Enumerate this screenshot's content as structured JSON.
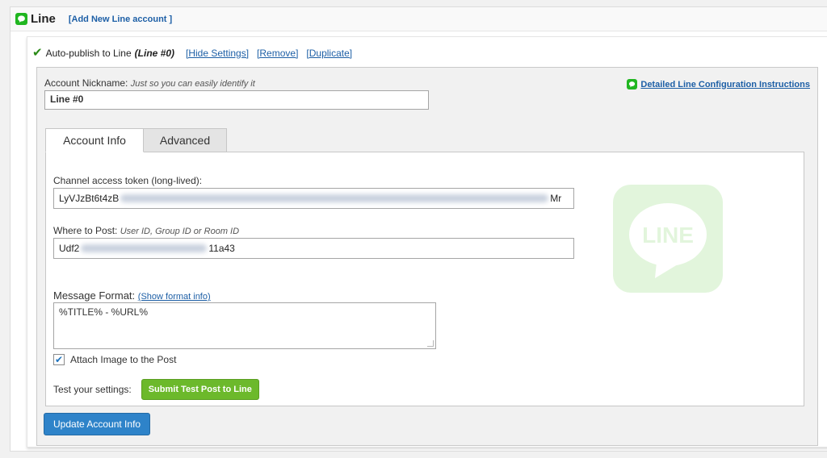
{
  "header": {
    "title": "Line",
    "add_link": "[Add New Line account ]"
  },
  "publish_row": {
    "checkbox_label": "Auto-publish to Line",
    "account_ref": "(Line #0)",
    "hide_settings": "[Hide Settings]",
    "remove": "[Remove]",
    "duplicate": "[Duplicate]"
  },
  "account": {
    "nickname_label": "Account Nickname:",
    "nickname_hint": "Just so you can easily identify it",
    "nickname_value": "Line #0",
    "instructions_link": "Detailed Line Configuration Instructions"
  },
  "tabs": [
    {
      "label": "Account Info",
      "active": true
    },
    {
      "label": "Advanced",
      "active": false
    }
  ],
  "account_info": {
    "token_label": "Channel access token (long-lived):",
    "token_value_start": "LyVJzBt6t4zB",
    "token_value_end": "Mr",
    "where_label": "Where to Post:",
    "where_hint": "User ID, Group ID or Room ID",
    "where_value_start": "Udf2",
    "where_value_end": "11a43",
    "message_label": "Message Format:",
    "show_format_link": "(Show format info)",
    "message_value": "%TITLE% - %URL%",
    "attach_label": "Attach Image to the Post",
    "attach_checked": true,
    "test_label": "Test your settings:",
    "test_button": "Submit Test Post to Line",
    "logo_text": "LINE"
  },
  "update_button": "Update Account Info",
  "colors": {
    "line_green": "#20b620",
    "link_blue": "#1d5fa6",
    "test_button_green": "#6cb92b",
    "update_button_blue": "#2e83c9"
  }
}
